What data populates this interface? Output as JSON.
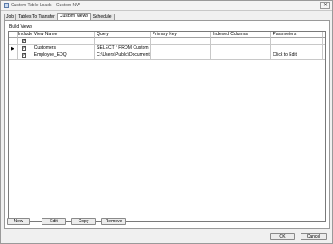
{
  "window": {
    "title": "Custom Table Loads - Custom NW",
    "close_glyph": "✕"
  },
  "tabs": [
    {
      "label": "Job"
    },
    {
      "label": "Tables To Transfer"
    },
    {
      "label": "Custom Views"
    },
    {
      "label": "Schedule"
    }
  ],
  "active_tab": "Custom Views",
  "panel": {
    "group_label": "Build Views"
  },
  "grid": {
    "columns": [
      "",
      "Include",
      "View Name",
      "Query",
      "Primary Key",
      "Indexed Columns",
      "Parameters"
    ],
    "rows": [
      {
        "include": true,
        "view_name": "",
        "query": "",
        "primary_key": "",
        "indexed_columns": "",
        "parameters": ""
      },
      {
        "include": true,
        "view_name": "Customers",
        "query": "SELECT * FROM Custom",
        "primary_key": "",
        "indexed_columns": "",
        "parameters": "",
        "current": true
      },
      {
        "include": true,
        "view_name": "Employee_EDQ",
        "query": "C:\\Users\\Public\\Document",
        "primary_key": "",
        "indexed_columns": "",
        "parameters": "Click to Edit"
      }
    ]
  },
  "buttons": {
    "new": "New",
    "edit": "Edit",
    "copy": "Copy",
    "remove": "Remove",
    "ok": "OK",
    "cancel": "Cancel"
  },
  "glyphs": {
    "check": "✓",
    "current_row": "▶"
  }
}
